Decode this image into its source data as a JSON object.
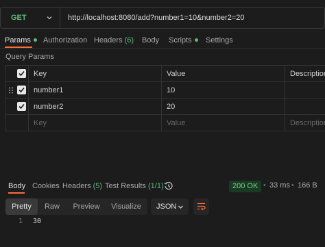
{
  "request": {
    "method": "GET",
    "url": "http://localhost:8080/add?number1=10&number2=20"
  },
  "request_tabs": [
    {
      "label": "Params",
      "active": true,
      "dot": true
    },
    {
      "label": "Authorization"
    },
    {
      "label": "Headers",
      "count": "(6)"
    },
    {
      "label": "Body"
    },
    {
      "label": "Scripts",
      "dot": true
    },
    {
      "label": "Settings"
    }
  ],
  "params": {
    "section_title": "Query Params",
    "headers": {
      "key": "Key",
      "value": "Value",
      "description": "Description"
    },
    "rows": [
      {
        "checked": true,
        "key": "number1",
        "value": "10"
      },
      {
        "checked": true,
        "key": "number2",
        "value": "20"
      }
    ],
    "placeholders": {
      "key": "Key",
      "value": "Value",
      "description": "Description"
    }
  },
  "response_tabs": [
    {
      "label": "Body",
      "active": true
    },
    {
      "label": "Cookies"
    },
    {
      "label": "Headers",
      "count": "(5)"
    },
    {
      "label": "Test Results",
      "count": "(1/1)"
    }
  ],
  "response_meta": {
    "status": "200 OK",
    "time": "33 ms",
    "size": "166 B",
    "separator": "•"
  },
  "format_tabs": [
    {
      "label": "Pretty",
      "active": true
    },
    {
      "label": "Raw"
    },
    {
      "label": "Preview"
    },
    {
      "label": "Visualize"
    }
  ],
  "language": "JSON",
  "response_body": {
    "line_number": "1",
    "content": "30"
  },
  "colors": {
    "accent": "#ff6c37",
    "success": "#5fb97b",
    "background": "#1c1c1c"
  },
  "icons": [
    "chevron-down-icon",
    "drag-handle-icon",
    "checkbox-checked-icon",
    "history-icon",
    "wrap-lines-icon"
  ]
}
